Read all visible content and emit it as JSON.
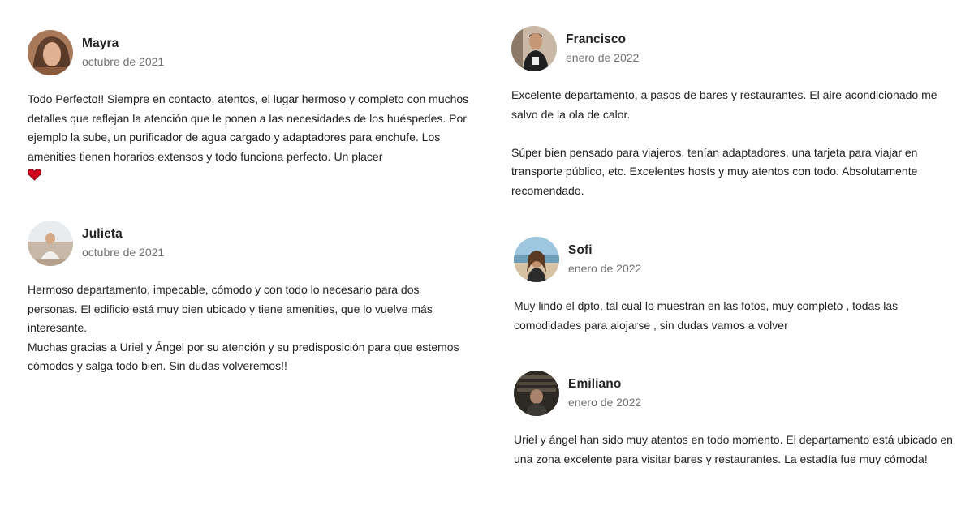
{
  "reviews": [
    {
      "name": "Mayra",
      "date": "octubre de 2021",
      "paragraphs": [
        "Todo Perfecto!! Siempre en contacto, atentos, el lugar hermoso y completo con muchos detalles que reflejan la atención que le ponen a las necesidades de los huéspedes. Por ejemplo la sube, un purificador de agua cargado y adaptadores para enchufe. Los amenities tienen horarios extensos y todo funciona perfecto. Un placer"
      ],
      "emoji": "red-heart-icon"
    },
    {
      "name": "Julieta",
      "date": "octubre de 2021",
      "paragraphs": [
        "Hermoso departamento, impecable, cómodo y con todo lo necesario para dos personas. El edificio está muy bien ubicado y tiene amenities, que lo vuelve más interesante.",
        "Muchas gracias a Uriel y Ángel por su atención y su predisposición para que estemos cómodos y salga todo bien. Sin dudas volveremos!!"
      ]
    },
    {
      "name": "Francisco",
      "date": "enero de 2022",
      "paragraphs": [
        "Excelente departamento, a pasos de bares y restaurantes. El aire acondicionado me salvo de la ola de calor.",
        "Súper bien pensado para viajeros, tenían adaptadores, una tarjeta para viajar en transporte público, etc. Excelentes hosts y muy atentos con todo. Absolutamente recomendado."
      ]
    },
    {
      "name": "Sofi",
      "date": "enero de 2022",
      "paragraphs": [
        "Muy lindo el dpto, tal cual lo muestran en las fotos, muy completo , todas las comodidades para alojarse , sin dudas vamos a volver"
      ]
    },
    {
      "name": "Emiliano",
      "date": "enero de 2022",
      "paragraphs": [
        "Uriel y ángel han sido muy atentos en todo momento. El departamento está ubicado en una zona excelente para visitar bares y restaurantes. La estadía fue muy cómoda!"
      ]
    }
  ]
}
